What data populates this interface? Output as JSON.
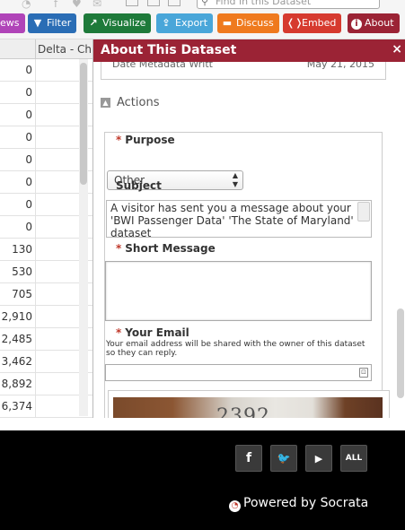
{
  "toolbar": {
    "search_placeholder": "Find in this Dataset",
    "buttons": [
      {
        "label": "ews",
        "color": "#b044b8",
        "icon": "views-icon"
      },
      {
        "label": "Filter",
        "color": "#2a6db5",
        "icon": "filter-icon",
        "glyph": "▼"
      },
      {
        "label": "Visualize",
        "color": "#1e7a3a",
        "icon": "visualize-icon",
        "glyph": "↗"
      },
      {
        "label": "Export",
        "color": "#49a6d9",
        "icon": "export-icon",
        "glyph": "⇪"
      },
      {
        "label": "Discuss",
        "color": "#ef7a1e",
        "icon": "discuss-icon",
        "glyph": "▬"
      },
      {
        "label": "Embed",
        "color": "#d63a2f",
        "icon": "embed-icon",
        "glyph": "❬❭"
      },
      {
        "label": "About",
        "color": "#9b2335",
        "icon": "about-icon",
        "glyph": "i"
      }
    ]
  },
  "grid": {
    "column_header": "Delta - Ch",
    "rows": [
      "0",
      "0",
      "0",
      "0",
      "0",
      "0",
      "0",
      "0",
      "130",
      "530",
      "705",
      "2,910",
      "2,485",
      "3,462",
      "8,892",
      "6,374"
    ]
  },
  "dialog": {
    "title": "About This Dataset",
    "close_glyph": "×",
    "metadata_key": "Date Metadata Writt",
    "metadata_value": "May 21, 2015",
    "section_title": "Actions",
    "required_mark": "*",
    "purpose": {
      "label": "Purpose",
      "value": "Other"
    },
    "subject": {
      "label": "Subject",
      "value": "A visitor has sent you a message about your 'BWI Passenger Data' 'The State of Maryland' dataset"
    },
    "short_message": {
      "label": "Short Message",
      "value": ""
    },
    "email": {
      "label": "Your Email",
      "note": "Your email address will be shared with the owner of this dataset so they can reply.",
      "value": ""
    },
    "captcha_text": "2392"
  },
  "footer": {
    "social": [
      {
        "name": "facebook-button",
        "glyph": "f"
      },
      {
        "name": "twitter-button",
        "glyph": "🐦"
      },
      {
        "name": "youtube-button",
        "glyph": "▶"
      },
      {
        "name": "all-button",
        "glyph": "ALL"
      }
    ],
    "powered_by": "Powered by Socrata"
  }
}
